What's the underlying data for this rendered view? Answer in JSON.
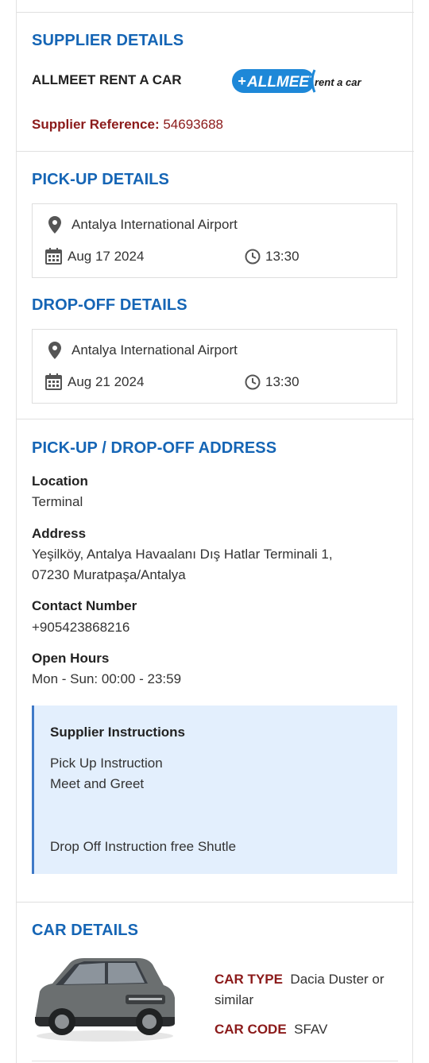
{
  "supplier": {
    "heading": "SUPPLIER DETAILS",
    "name": "ALLMEET RENT A CAR",
    "logo_text": "ALLMEET",
    "logo_sub": "rent a car",
    "reference_label": "Supplier Reference:",
    "reference_value": "54693688"
  },
  "pickup": {
    "heading": "PICK-UP DETAILS",
    "location": "Antalya International Airport",
    "date": "Aug 17 2024",
    "time": "13:30"
  },
  "dropoff": {
    "heading": "DROP-OFF DETAILS",
    "location": "Antalya International Airport",
    "date": "Aug 21 2024",
    "time": "13:30"
  },
  "address": {
    "heading": "PICK-UP / DROP-OFF ADDRESS",
    "location_label": "Location",
    "location_value": "Terminal",
    "address_label": "Address",
    "address_line1": "Yeşilköy, Antalya Havaalanı Dış Hatlar Terminali 1,",
    "address_line2": "07230 Muratpaşa/Antalya",
    "contact_label": "Contact Number",
    "contact_value": "+905423868216",
    "hours_label": "Open Hours",
    "hours_value": "Mon - Sun: 00:00 - 23:59"
  },
  "instructions": {
    "title": "Supplier Instructions",
    "line1": "Pick Up Instruction",
    "line2": "Meet and Greet",
    "line3": "Drop Off Instruction free Shutle"
  },
  "car": {
    "heading": "CAR DETAILS",
    "type_label": "CAR TYPE",
    "type_value_1": "Dacia Duster or",
    "type_value_2": "similar",
    "code_label": "CAR CODE",
    "code_value": "SFAV"
  },
  "colors": {
    "heading_blue": "#1565b5",
    "label_red": "#8b1a1a",
    "instruction_bg": "#e3effd"
  }
}
